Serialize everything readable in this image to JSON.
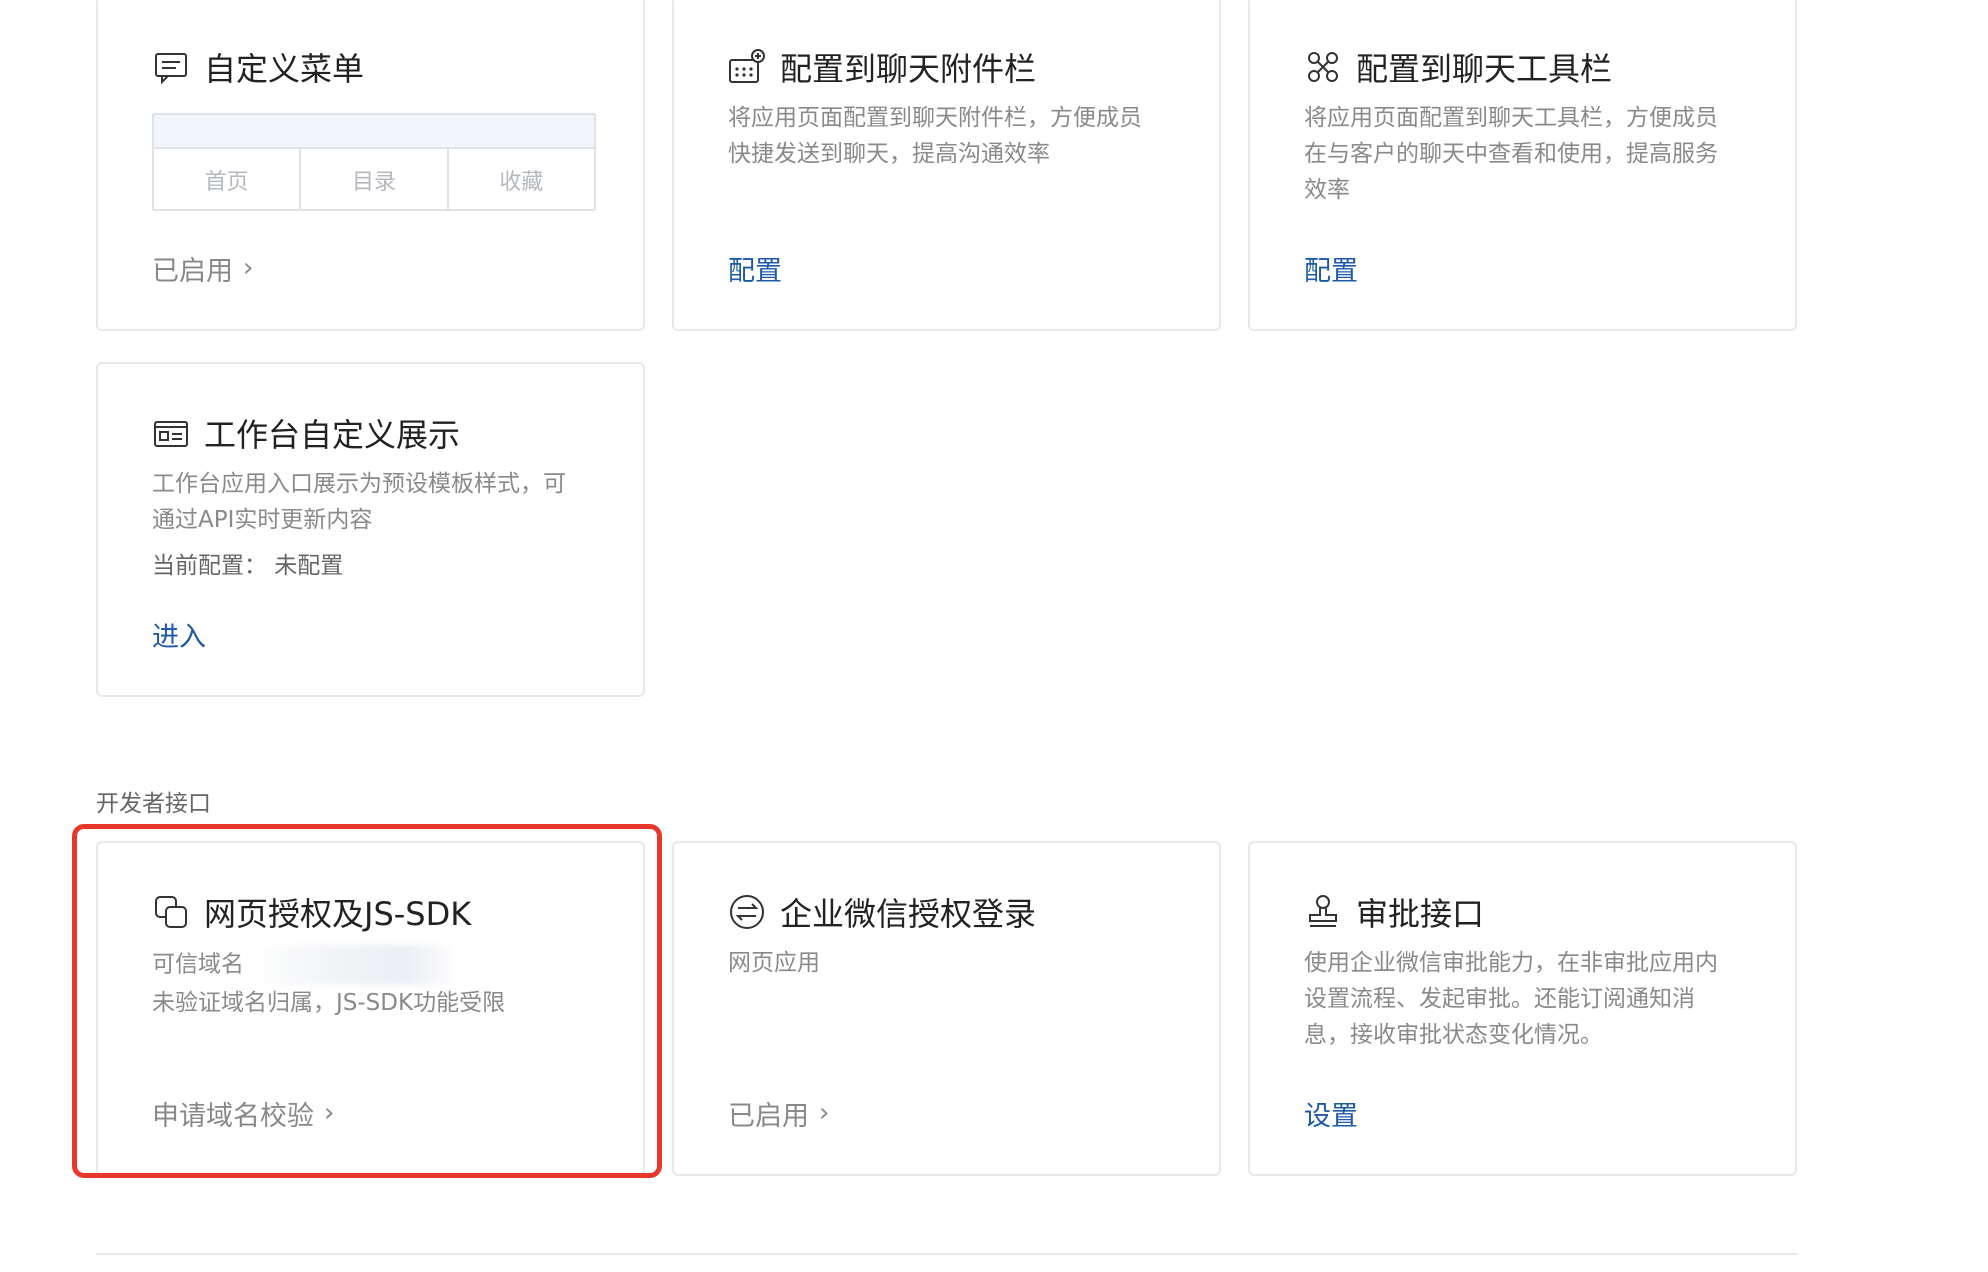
{
  "cards_row1": [
    {
      "title": "自定义菜单",
      "icon": "chat-menu-icon",
      "menu_preview": [
        "首页",
        "目录",
        "收藏"
      ],
      "action": "已启用"
    },
    {
      "title": "配置到聊天附件栏",
      "icon": "attachment-grid-plus-icon",
      "desc": [
        "将应用页面配置到聊天附件栏，方便成员",
        "快捷发送到聊天，提高沟通效率"
      ],
      "action": "配置"
    },
    {
      "title": "配置到聊天工具栏",
      "icon": "toolbar-cross-icon",
      "desc": [
        "将应用页面配置到聊天工具栏，方便成员",
        "在与客户的聊天中查看和使用，提高服务",
        "效率"
      ],
      "action": "配置"
    }
  ],
  "card_workbench": {
    "title": "工作台自定义展示",
    "icon": "id-card-icon",
    "desc": [
      "工作台应用入口展示为预设模板样式，可",
      "通过API实时更新内容"
    ],
    "config_line": "当前配置：  未配置",
    "action": "进入"
  },
  "section_label": "开发者接口",
  "cards_dev": [
    {
      "title": "网页授权及JS-SDK",
      "icon": "copy-squares-icon",
      "desc": [
        "可信域名",
        "未验证域名归属，JS-SDK功能受限"
      ],
      "action": "申请域名校验"
    },
    {
      "title": "企业微信授权登录",
      "icon": "exchange-circle-icon",
      "desc": [
        "网页应用"
      ],
      "action": "已启用"
    },
    {
      "title": "审批接口",
      "icon": "stamp-icon",
      "desc": [
        "使用企业微信审批能力，在非审批应用内",
        "设置流程、发起审批。还能订阅通知消",
        "息，接收审批状态变化情况。"
      ],
      "action": "设置"
    }
  ],
  "colors": {
    "link": "#1f5aa6",
    "highlight": "#e8382b",
    "border": "#e6e8eb"
  }
}
